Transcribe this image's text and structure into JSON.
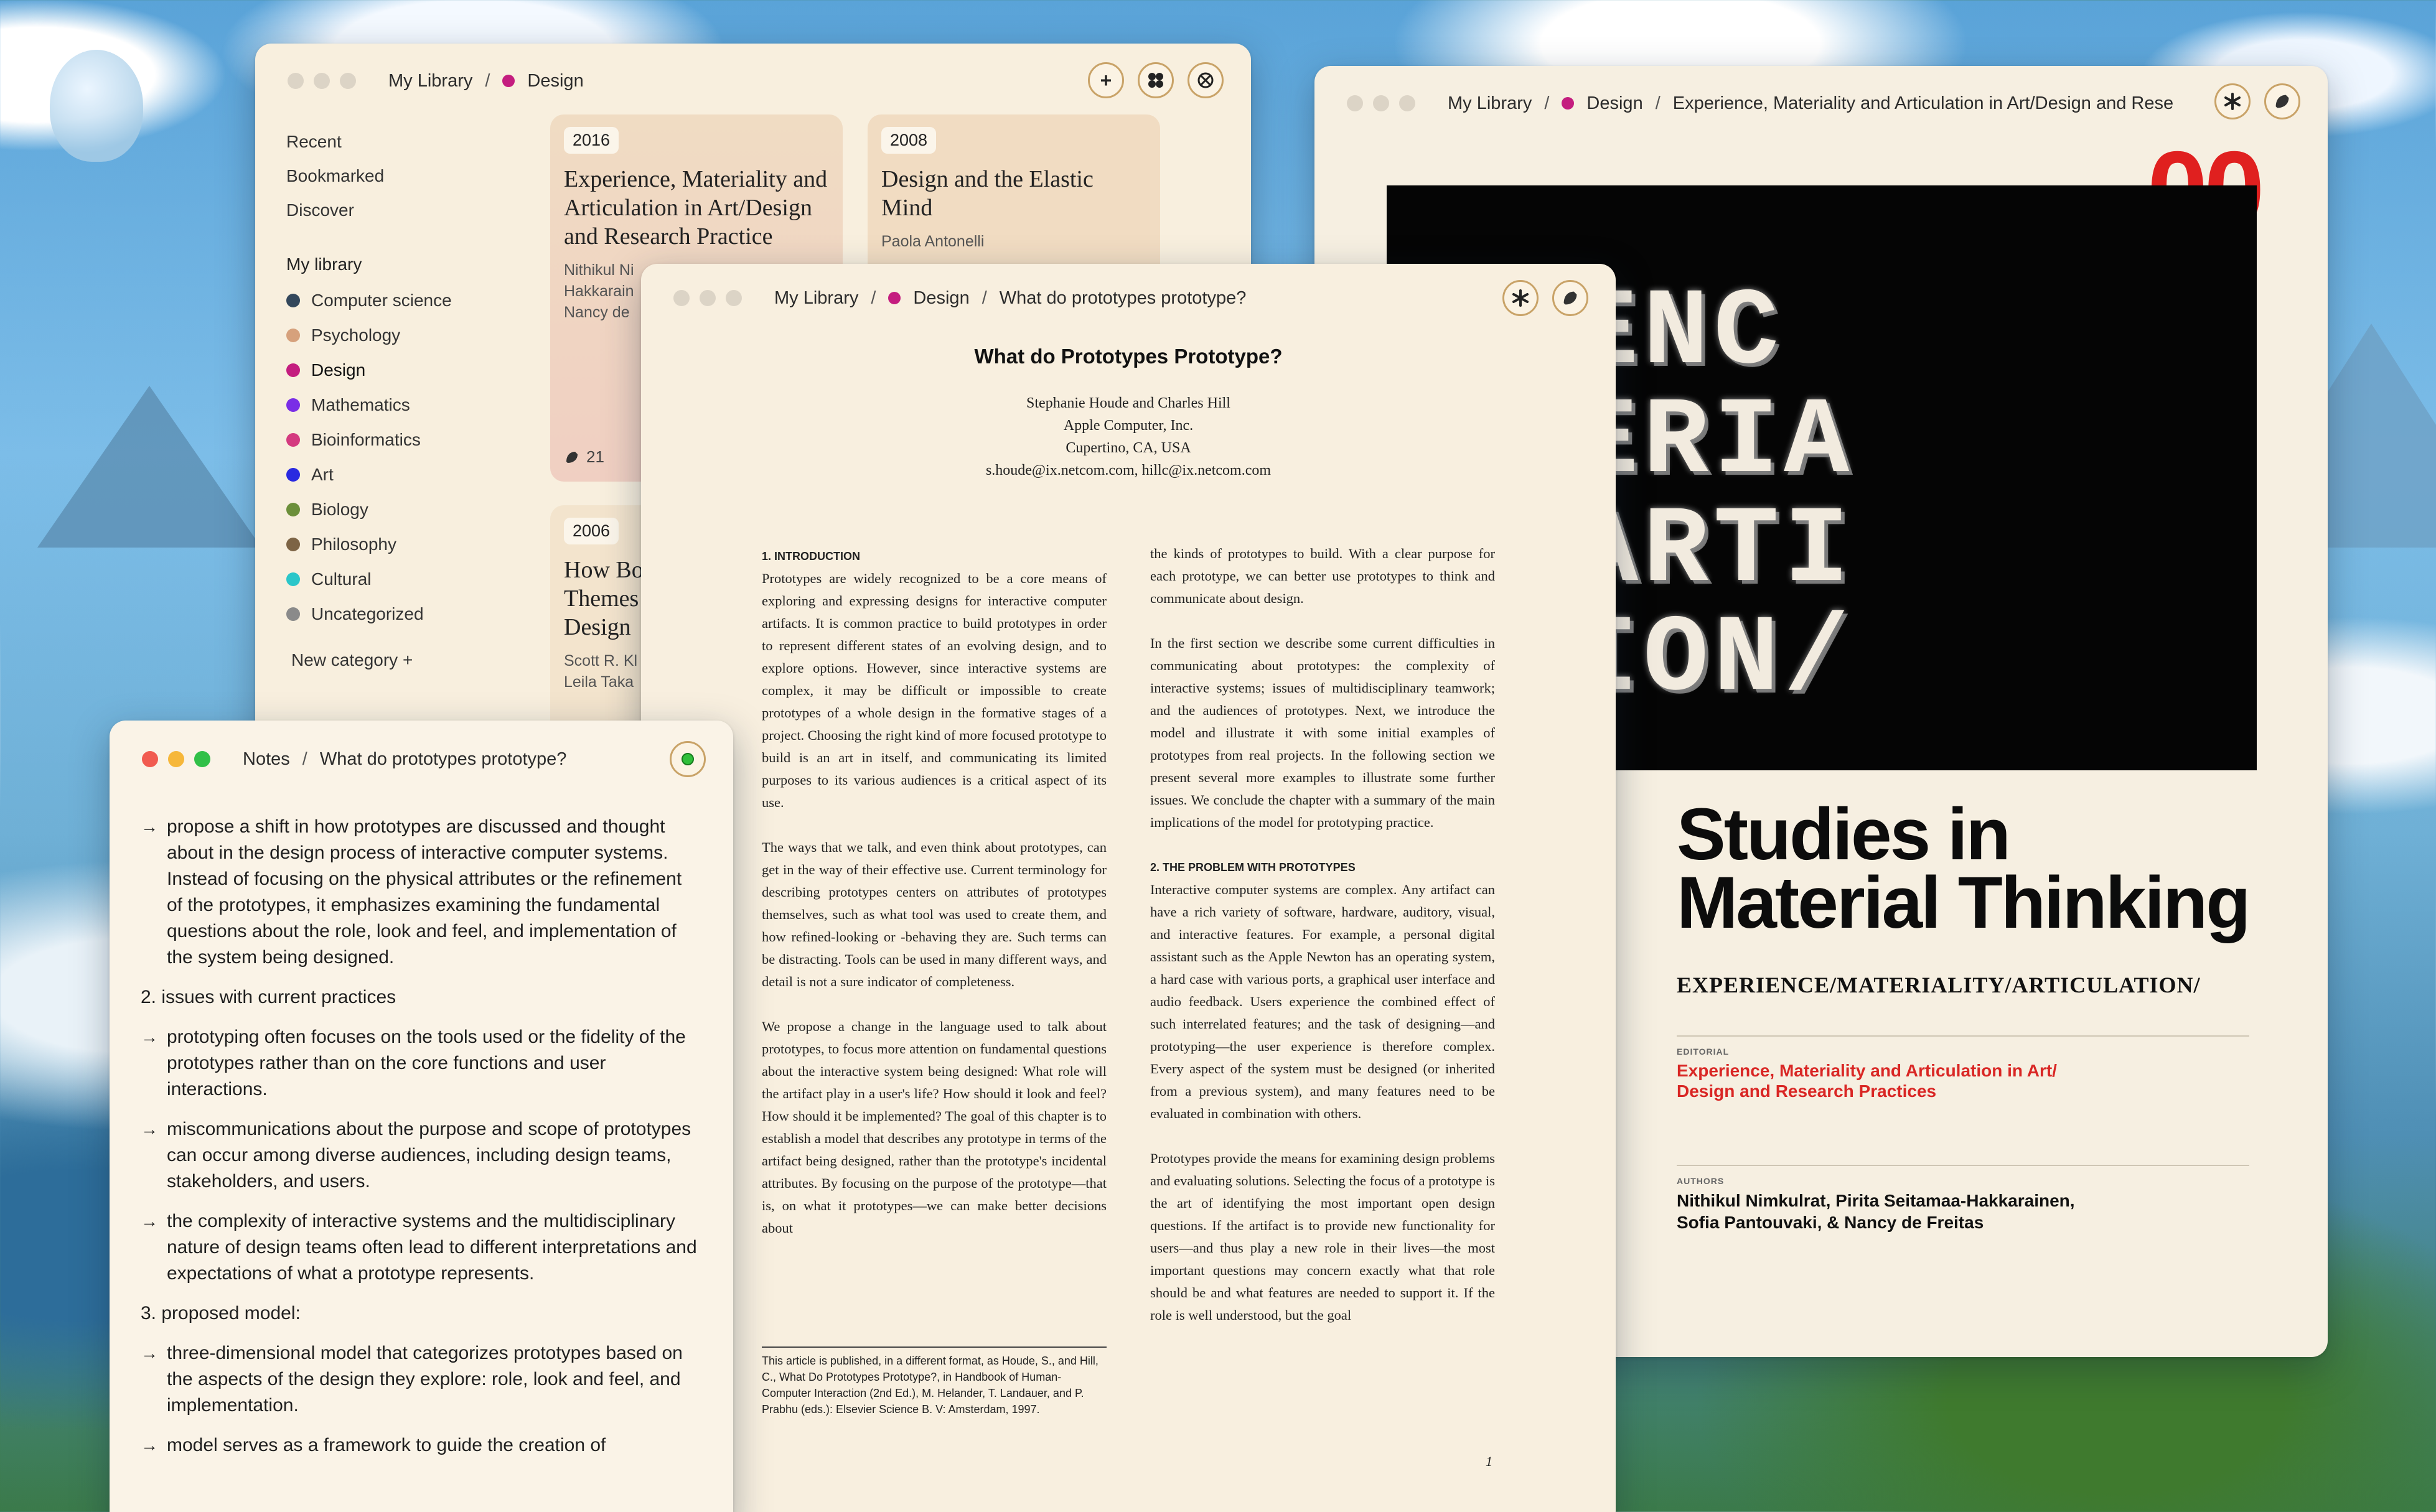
{
  "colors": {
    "design": "#c41d7f",
    "computer_science": "#33475b",
    "psychology": "#d6a17c",
    "mathematics": "#7a2ee6",
    "bioinformatics": "#d43a7f",
    "art": "#2929e0",
    "biology": "#6c8f3a",
    "philosophy": "#7d6445",
    "cultural": "#2bc6c9",
    "uncategorized": "#8a8a8a",
    "accent_red": "#e0201f"
  },
  "library": {
    "breadcrumb": [
      "My Library",
      "Design"
    ],
    "actions": [
      "+",
      "plus-circle-icon",
      "grid-icon",
      "share-icon"
    ],
    "sidebar": {
      "links": [
        "Recent",
        "Bookmarked",
        "Discover"
      ],
      "heading": "My library",
      "categories": [
        {
          "name": "Computer science"
        },
        {
          "name": "Psychology"
        },
        {
          "name": "Design"
        },
        {
          "name": "Mathematics"
        },
        {
          "name": "Bioinformatics"
        },
        {
          "name": "Art"
        },
        {
          "name": "Biology"
        },
        {
          "name": "Philosophy"
        },
        {
          "name": "Cultural"
        },
        {
          "name": "Uncategorized"
        }
      ],
      "new_category": "New category  +"
    },
    "cards": [
      {
        "year": "2016",
        "title": "Experience, Materiality and Articulation in Art/Design and Research Practice",
        "authors": "Nithikul Ni\nHakkarain\nNancy de",
        "count": "21"
      },
      {
        "year": "2008",
        "title": "Design and the Elastic Mind",
        "authors": "Paola Antonelli"
      },
      {
        "year": "2006",
        "title": "How Bo Themes Design",
        "authors": "Scott R. Kl\nLeila Taka"
      }
    ]
  },
  "cover": {
    "breadcrumb": [
      "My Library",
      "Design",
      "Experience, Materiality and Articulation in Art/Design and Rese"
    ],
    "number": "00",
    "art_lines": [
      "ERIENC",
      "MATERIA",
      "TY/ARTI",
      "LATION/"
    ],
    "title_line1": "Studies in",
    "title_line2": "Material Thinking",
    "subtitle": "EXPERIENCE/MATERIALITY/ARTICULATION/",
    "editorial_label": "EDITORIAL",
    "editorial_line1": "Experience, Materiality and Articulation in Art/",
    "editorial_line2": "Design and Research Practices",
    "authors_label": "AUTHORS",
    "authors_line1": "Nithikul Nimkulrat, Pirita Seitamaa-Hakkarainen,",
    "authors_line2": "Sofia Pantouvaki, & Nancy de Freitas"
  },
  "paper": {
    "breadcrumb": [
      "My Library",
      "Design",
      "What do prototypes prototype?"
    ],
    "title": "What do Prototypes Prototype?",
    "authors": [
      "Stephanie Houde and Charles Hill",
      "Apple Computer, Inc.",
      "Cupertino, CA, USA",
      "s.houde@ix.netcom.com, hillc@ix.netcom.com"
    ],
    "left_col": {
      "h1": "1. INTRODUCTION",
      "p1": "Prototypes are widely recognized to be a core means of exploring and expressing designs for interactive computer artifacts. It is common practice to build prototypes in order to represent different states of an evolving design, and to explore options. However, since interactive systems are complex, it may be difficult or impossible to create prototypes of a whole design in the formative stages of a project. Choosing the right kind of more focused prototype to build is an art in itself, and communicating its limited purposes to its various audiences is a critical aspect of its use.",
      "p2": "The ways that we talk, and even think about prototypes, can get in the way of their effective use. Current terminology for describing prototypes centers on attributes of prototypes themselves, such as what tool was used to create them, and how refined-looking or -behaving they are. Such terms can be distracting. Tools can be used in many different ways, and detail is not a sure indicator of completeness.",
      "p3": "We propose a change in the language used to talk about prototypes, to focus more attention on fundamental questions about the interactive system being designed: What role will the artifact play in a user's life? How should it look and feel? How should it be implemented? The goal of this chapter is to establish a model that describes any prototype in terms of the artifact being designed, rather than the prototype's incidental attributes. By focusing on the purpose of the prototype—that is, on what it prototypes—we can make better decisions about"
    },
    "right_col": {
      "p1": "the kinds of prototypes to build. With a clear purpose for each prototype, we can better use prototypes to think and communicate about design.",
      "p2": "In the first section we describe some current difficulties in communicating about prototypes: the complexity of interactive systems; issues of multidisciplinary teamwork; and the audiences of prototypes. Next, we introduce the model and illustrate it with some initial examples of prototypes from real projects. In the following section we present several more examples to illustrate some further issues. We conclude the chapter with a summary of the main implications of the model for prototyping practice.",
      "h2": "2. THE PROBLEM WITH PROTOTYPES",
      "p3": "Interactive computer systems are complex. Any artifact can have a rich variety of software, hardware, auditory, visual, and interactive features. For example, a personal digital assistant such as the Apple Newton has an operating system, a hard case with various ports, a graphical user interface and audio feedback. Users experience the combined effect of such interrelated features; and the task of designing—and prototyping—the user experience is therefore complex. Every aspect of the system must be designed (or inherited from a previous system), and many features need to be evaluated in combination with others.",
      "p4": "Prototypes provide the means for examining design problems and evaluating solutions. Selecting the focus of a prototype is the art of identifying the most important open design questions. If the artifact is to provide new functionality for users—and thus play a new role in their lives—the most important questions may concern exactly what that role should be and what features are needed to support it. If the role is well understood, but the goal"
    },
    "footnote": "This article is published, in a different format, as Houde, S., and Hill, C., What Do Prototypes Prototype?, in Handbook of Human-Computer Interaction (2nd Ed.), M. Helander, T. Landauer, and P. Prabhu (eds.): Elsevier Science B. V: Amsterdam, 1997.",
    "page": "1"
  },
  "notes": {
    "breadcrumb": [
      "Notes",
      "What do prototypes prototype?"
    ],
    "b0": "propose a shift in how prototypes are discussed and thought about in the design process of interactive computer systems. Instead of focusing on the physical attributes or the refinement of the prototypes, it emphasizes examining the fundamental questions about the role, look and feel, and implementation of the system being designed.",
    "h2": "2. issues with current practices",
    "b1": "prototyping often focuses on the tools used or the fidelity of the prototypes rather than on the core functions and user interactions.",
    "b2": "miscommunications about the purpose and scope of prototypes can occur among diverse audiences, including design teams, stakeholders, and users.",
    "b3": "the complexity of interactive systems and the multidisciplinary nature of design teams often lead to different interpretations and expectations of what a prototype represents.",
    "h3": "3. proposed model:",
    "b4": "three-dimensional model that categorizes prototypes based on the aspects of the design they explore: role, look and feel, and implementation.",
    "b5": "model serves as a framework to guide the creation of"
  }
}
